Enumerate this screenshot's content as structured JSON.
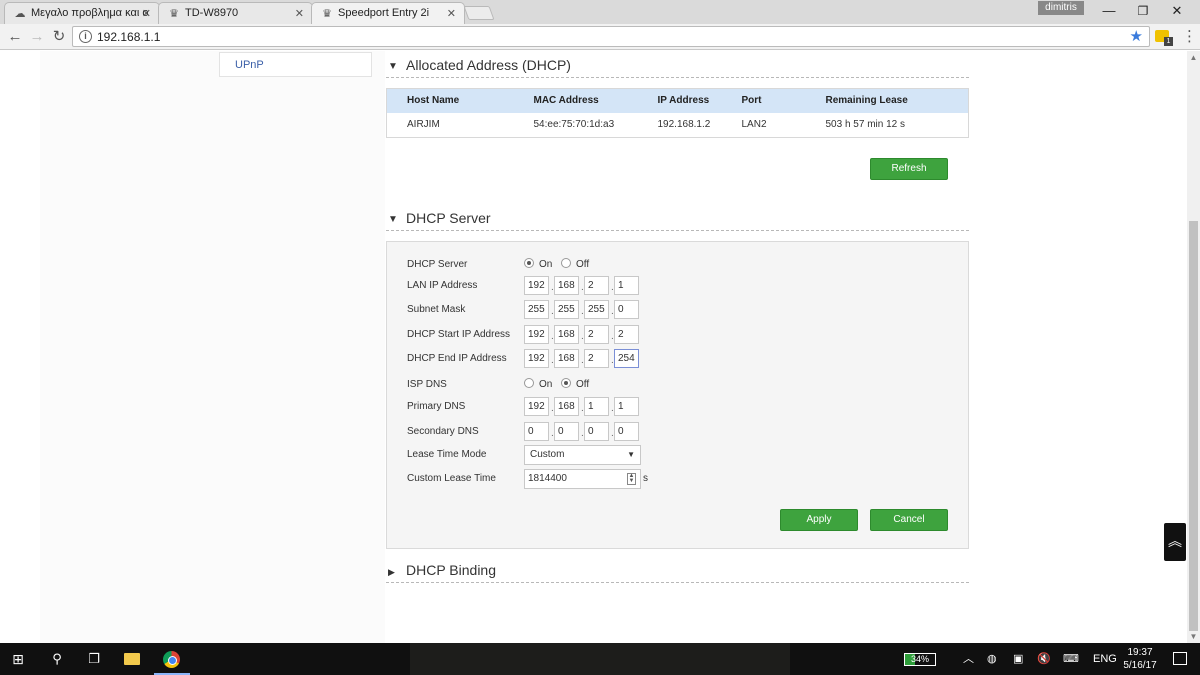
{
  "browser": {
    "tabs": [
      {
        "title": "Μεγαλο προβλημα και ο",
        "icon": "forum-icon"
      },
      {
        "title": "TD-W8970",
        "icon": "router-icon"
      },
      {
        "title": "Speedport Entry 2i",
        "icon": "router-icon"
      }
    ],
    "profile_name": "dimitris",
    "url": "192.168.1.1",
    "extension_badge": "1"
  },
  "sidebar": {
    "items": [
      {
        "label": "UPnP"
      }
    ]
  },
  "allocated": {
    "title": "Allocated Address (DHCP)",
    "columns": [
      "Host Name",
      "MAC Address",
      "IP Address",
      "Port",
      "Remaining Lease"
    ],
    "rows": [
      [
        "AIRJIM",
        "54:ee:75:70:1d:a3",
        "192.168.1.2",
        "LAN2",
        "503 h 57 min 12 s"
      ]
    ],
    "refresh_label": "Refresh"
  },
  "dhcp_server": {
    "title": "DHCP Server",
    "fields": {
      "server": {
        "label": "DHCP Server",
        "on_label": "On",
        "off_label": "Off",
        "selected": "On"
      },
      "lan_ip": {
        "label": "LAN IP Address",
        "octets": [
          "192",
          "168",
          "2",
          "1"
        ]
      },
      "subnet": {
        "label": "Subnet Mask",
        "octets": [
          "255",
          "255",
          "255",
          "0"
        ]
      },
      "start_ip": {
        "label": "DHCP Start IP Address",
        "octets": [
          "192",
          "168",
          "2",
          "2"
        ]
      },
      "end_ip": {
        "label": "DHCP End IP Address",
        "octets": [
          "192",
          "168",
          "2",
          "254"
        ]
      },
      "isp_dns": {
        "label": "ISP DNS",
        "on_label": "On",
        "off_label": "Off",
        "selected": "Off"
      },
      "primary_dns": {
        "label": "Primary DNS",
        "octets": [
          "192",
          "168",
          "1",
          "1"
        ]
      },
      "secondary_dns": {
        "label": "Secondary DNS",
        "octets": [
          "0",
          "0",
          "0",
          "0"
        ]
      },
      "lease_mode": {
        "label": "Lease Time Mode",
        "value": "Custom"
      },
      "lease_time": {
        "label": "Custom Lease Time",
        "value": "1814400",
        "unit": "s"
      }
    },
    "apply_label": "Apply",
    "cancel_label": "Cancel"
  },
  "dhcp_binding": {
    "title": "DHCP Binding"
  },
  "taskbar": {
    "battery": "34%",
    "language": "ENG",
    "time": "19:37",
    "date": "5/16/17"
  },
  "colors": {
    "button_green": "#3ea33e",
    "table_header": "#d4e5f7",
    "link_blue": "#3a5fa8"
  }
}
